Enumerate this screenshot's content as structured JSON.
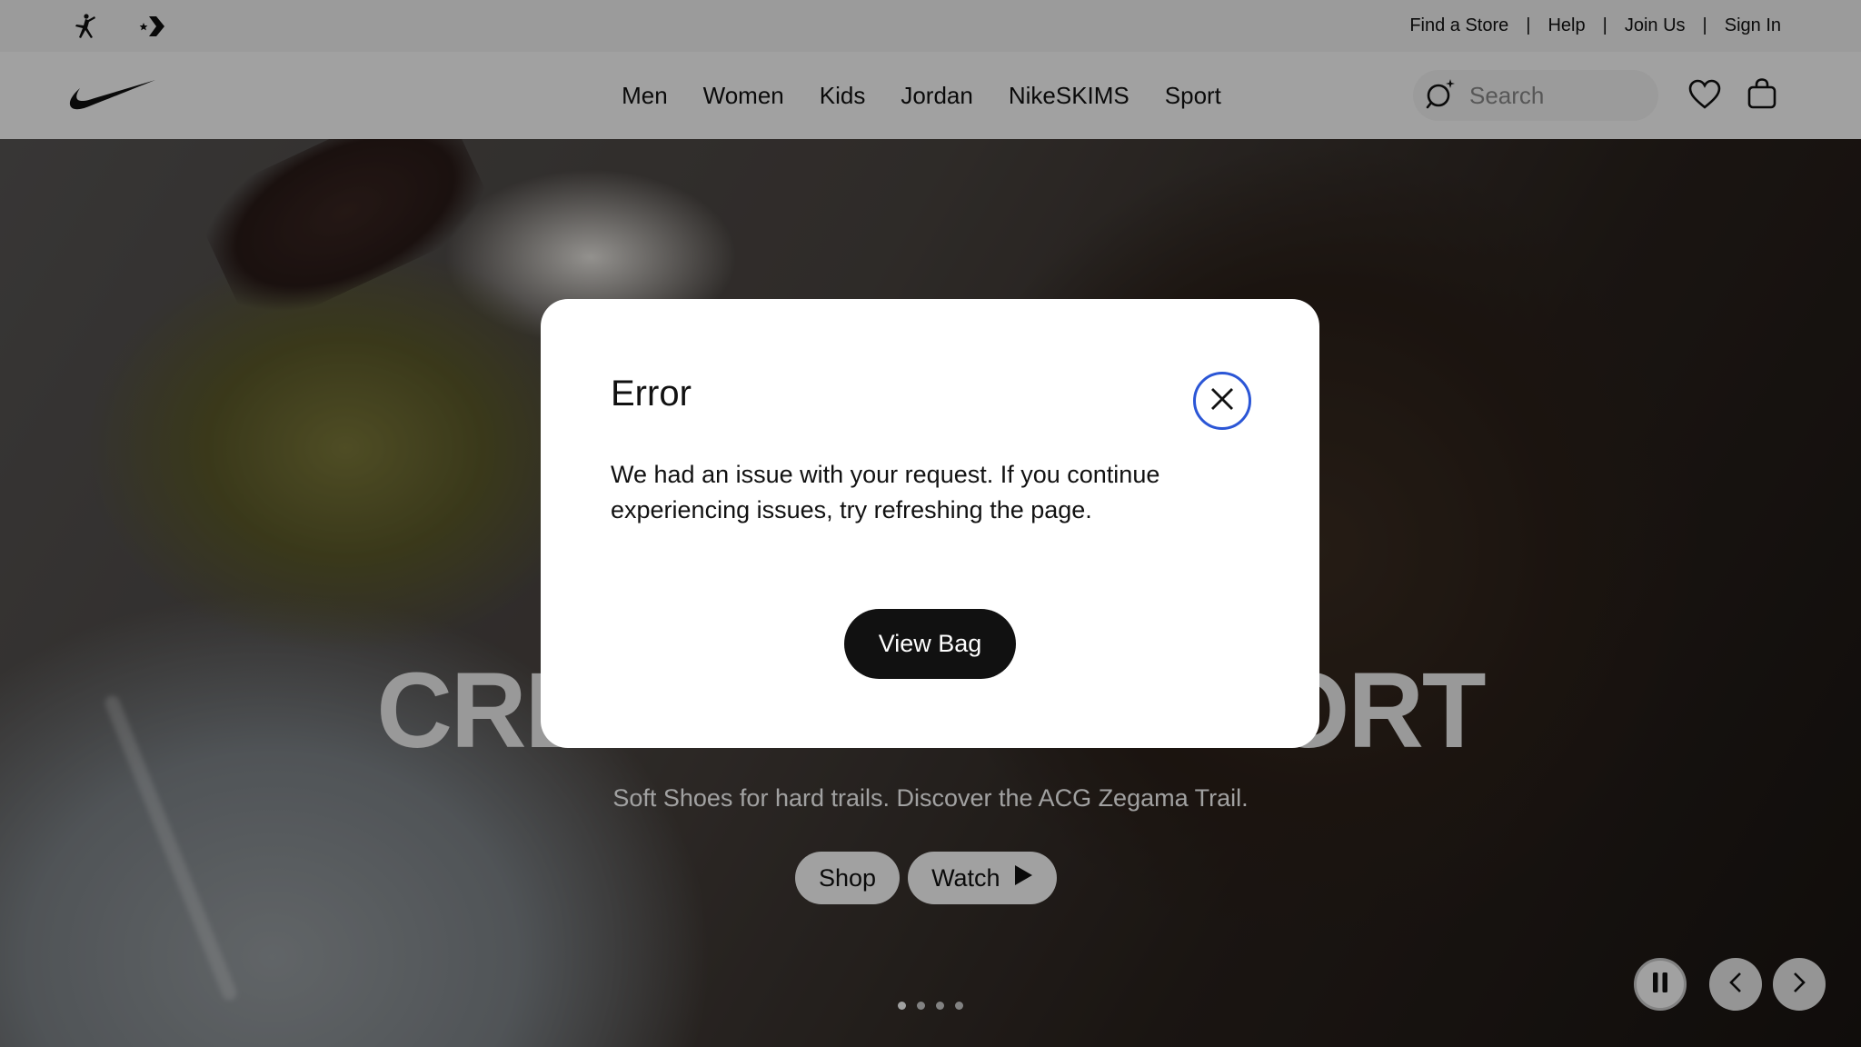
{
  "utility_bar": {
    "links": [
      {
        "label": "Find a Store"
      },
      {
        "label": "Help"
      },
      {
        "label": "Join Us"
      },
      {
        "label": "Sign In"
      }
    ],
    "separator": "|",
    "icons": [
      "jordan-jumpman-icon",
      "converse-star-chevron-icon"
    ]
  },
  "main_nav": {
    "logo": "nike-swoosh-icon",
    "links": [
      "Men",
      "Women",
      "Kids",
      "Jordan",
      "NikeSKIMS",
      "Sport"
    ],
    "search": {
      "placeholder": "Search",
      "icon": "search-icon"
    },
    "icons": [
      "heart-icon",
      "bag-icon"
    ]
  },
  "hero": {
    "title": "CREATURE COMFORT",
    "subtitle": "Soft Shoes for hard trails. Discover the ACG Zegama Trail.",
    "shop_label": "Shop",
    "watch_label": "Watch",
    "slide_count": 4,
    "active_slide": 1,
    "controls": [
      "pause-icon",
      "chevron-left-icon",
      "chevron-right-icon"
    ]
  },
  "modal": {
    "title": "Error",
    "body": "We had an issue with your request. If you continue experiencing issues, try refreshing the page.",
    "button_label": "View Bag",
    "close_icon": "close-icon"
  },
  "colors": {
    "overlay": "#000000",
    "close_focus_ring": "#2b56d6",
    "primary_button": "#111111"
  }
}
